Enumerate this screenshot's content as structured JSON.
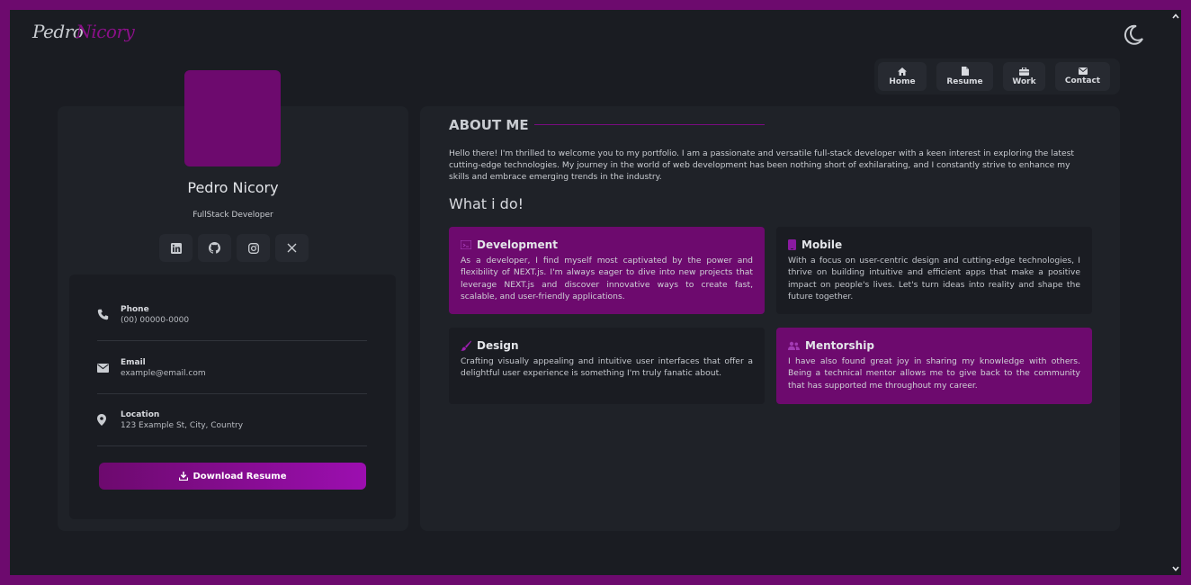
{
  "header": {
    "logo_first": "Pedro",
    "logo_last": "Nicory",
    "theme_icon": "moon-icon"
  },
  "nav": {
    "items": [
      {
        "label": "Home",
        "icon": "home-icon"
      },
      {
        "label": "Resume",
        "icon": "document-icon"
      },
      {
        "label": "Work",
        "icon": "briefcase-icon"
      },
      {
        "label": "Contact",
        "icon": "envelope-icon"
      }
    ]
  },
  "profile": {
    "name": "Pedro Nicory",
    "role": "FullStack Developer",
    "socials": [
      "linkedin-icon",
      "github-icon",
      "instagram-icon",
      "x-icon"
    ]
  },
  "contact": {
    "phone_label": "Phone",
    "phone_value": "(00) 00000-0000",
    "email_label": "Email",
    "email_value": "example@email.com",
    "location_label": "Location",
    "location_value": "123 Example St, City, Country",
    "download_label": "Download Resume"
  },
  "about": {
    "title": "ABOUT ME",
    "text": "Hello there! I'm thrilled to welcome you to my portfolio. I am a passionate and versatile full-stack developer with a keen interest in exploring the latest cutting-edge technologies. My journey in the world of web development has been nothing short of exhilarating, and I constantly strive to enhance my skills and embrace emerging trends in the industry.",
    "what_title": "What i do!"
  },
  "services": [
    {
      "title": "Development",
      "icon": "code-icon",
      "text": "As a developer, I find myself most captivated by the power and flexibility of NEXT.js. I'm always eager to dive into new projects that leverage NEXT.js and discover innovative ways to create fast, scalable, and user-friendly applications."
    },
    {
      "title": "Mobile",
      "icon": "mobile-icon",
      "text": "With a focus on user-centric design and cutting-edge technologies, I thrive on building intuitive and efficient apps that make a positive impact on people's lives. Let's turn ideas into reality and shape the future together."
    },
    {
      "title": "Design",
      "icon": "paintbrush-icon",
      "text": "Crafting visually appealing and intuitive user interfaces that offer a delightful user experience is something I'm truly fanatic about."
    },
    {
      "title": "Mentorship",
      "icon": "users-icon",
      "text": "I have also found great joy in sharing my knowledge with others. Being a technical mentor allows me to give back to the community that has supported me throughout my career."
    }
  ],
  "colors": {
    "accent": "#6d0a6e",
    "background": "#1a1c22",
    "card": "#1f2228"
  }
}
